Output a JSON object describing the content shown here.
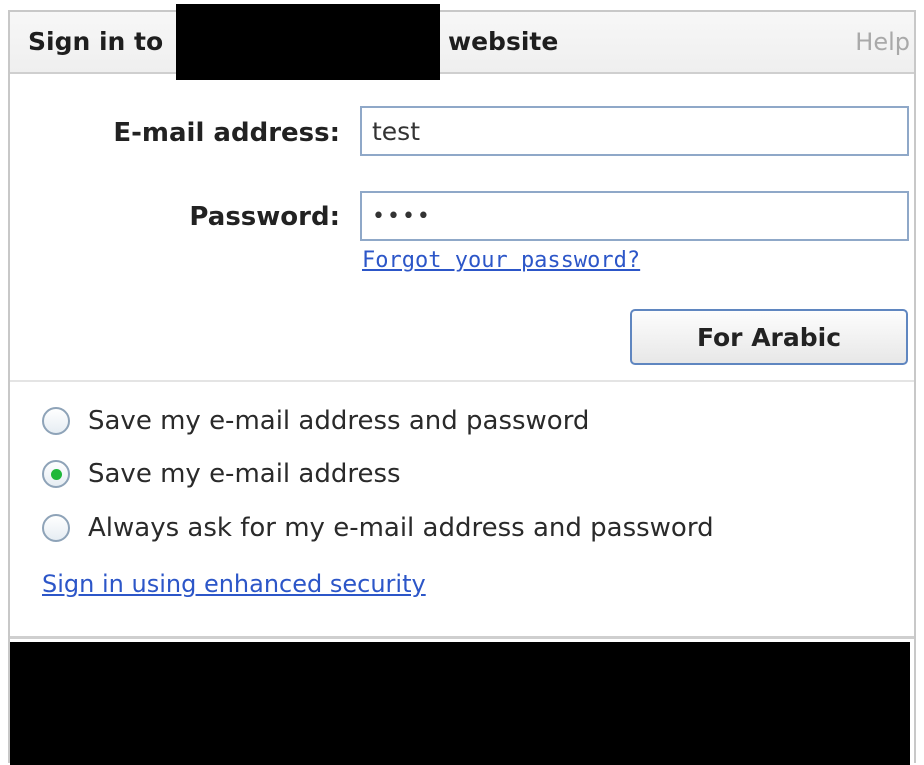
{
  "header": {
    "title_prefix": "Sign in to",
    "title_suffix": "website",
    "help_label": "Help"
  },
  "form": {
    "email_label": "E-mail address:",
    "email_value": "test",
    "password_label": "Password:",
    "password_mask": "••••",
    "forgot_link": "Forgot your password?",
    "submit_label": "For Arabic"
  },
  "options": {
    "selected_index": 1,
    "items": [
      {
        "label": "Save my e-mail address and password",
        "selected": false
      },
      {
        "label": "Save my e-mail address",
        "selected": true
      },
      {
        "label": "Always ask for my e-mail address and password",
        "selected": false
      }
    ]
  },
  "security_link": "Sign in using enhanced security",
  "colors": {
    "link": "#2c56c8",
    "radio_selected": "#1fb839",
    "button_border": "#5f86c0"
  }
}
